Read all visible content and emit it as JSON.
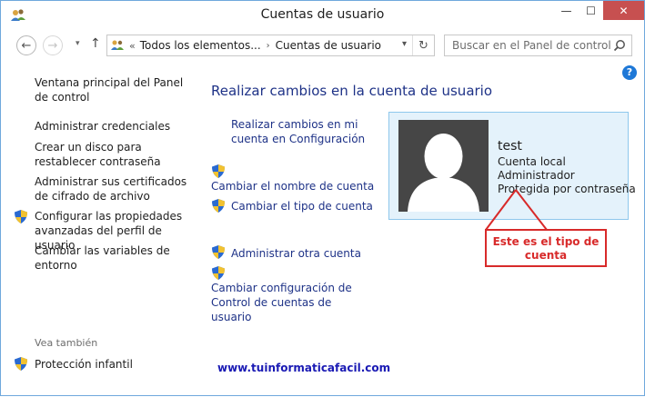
{
  "window": {
    "title": "Cuentas de usuario",
    "controls": {
      "minimize": "—",
      "maximize": "☐",
      "close": "✕"
    }
  },
  "nav": {
    "back": "←",
    "forward": "→",
    "up": "↑",
    "breadcrumb_sep": "«",
    "crumbs": [
      "Todos los elementos...",
      "Cuentas de usuario"
    ],
    "crumb_arrow": "›",
    "refresh": "↻",
    "search_placeholder": "Buscar en el Panel de control"
  },
  "help_label": "?",
  "sidebar": {
    "links": [
      {
        "label": "Ventana principal del Panel de control",
        "shield": false
      },
      {
        "label": "Administrar credenciales",
        "shield": false
      },
      {
        "label": "Crear un disco para restablecer contraseña",
        "shield": false
      },
      {
        "label": "Administrar sus certificados de cifrado de archivo",
        "shield": false
      },
      {
        "label": "Configurar las propiedades avanzadas del perfil de usuario",
        "shield": true
      },
      {
        "label": "Cambiar las variables de entorno",
        "shield": false
      }
    ],
    "see_also": "Vea también",
    "see_also_links": [
      {
        "label": "Protección infantil",
        "shield": true
      }
    ]
  },
  "main": {
    "title": "Realizar cambios en la cuenta de usuario",
    "links": [
      {
        "label": "Realizar cambios en mi cuenta en Configuración",
        "shield": false
      },
      {
        "label": "Cambiar el nombre de cuenta",
        "shield": true
      },
      {
        "label": "Cambiar el tipo de cuenta",
        "shield": true
      },
      {
        "label": "Administrar otra cuenta",
        "shield": true
      },
      {
        "label": "Cambiar configuración de Control de cuentas de usuario",
        "shield": true
      }
    ]
  },
  "user": {
    "name": "test",
    "lines": [
      "Cuenta local",
      "Administrador",
      "Protegida por contraseña"
    ]
  },
  "annotation": {
    "text": "Este es el tipo de cuenta",
    "color": "#d82a2a"
  },
  "watermark": "www.tuinformaticafacil.com",
  "colors": {
    "link": "#1e3287",
    "card_bg": "#e4f2fb",
    "card_border": "#8ec7ec",
    "close_button": "#c75050"
  }
}
